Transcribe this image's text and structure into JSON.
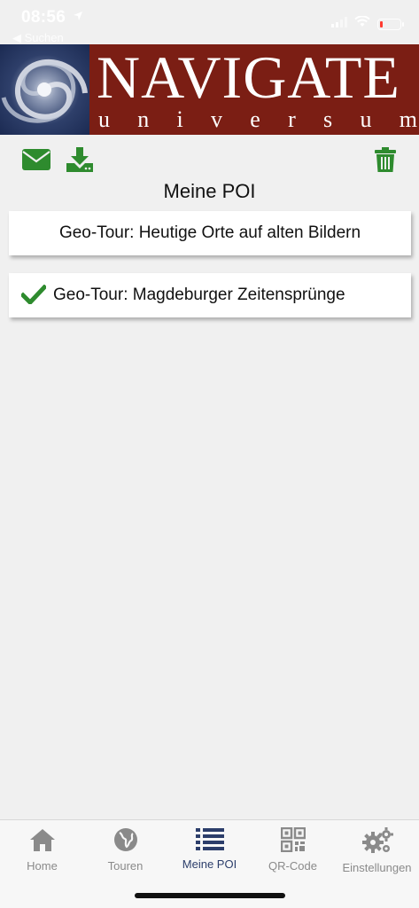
{
  "status": {
    "time": "08:56",
    "back_label": "◀ Suchen"
  },
  "banner": {
    "title": "NAVIGATE",
    "subtitle_letters": [
      "u",
      "n",
      "i",
      "v",
      "e",
      "r",
      "s",
      "u",
      "m"
    ]
  },
  "toolbar": {
    "mail_icon": "envelope-icon",
    "download_icon": "download-icon",
    "trash_icon": "trash-icon",
    "accent_color": "#2e8b2e"
  },
  "page": {
    "title": "Meine POI"
  },
  "poi_items": [
    {
      "label": "Geo-Tour: Heutige Orte auf alten Bildern",
      "checked": false
    },
    {
      "label": "Geo-Tour: Magdeburger Zeitensprünge",
      "checked": true
    }
  ],
  "tabbar": {
    "tabs": [
      {
        "label": "Home",
        "icon": "home-icon"
      },
      {
        "label": "Touren",
        "icon": "globe-icon"
      },
      {
        "label": "Meine POI",
        "icon": "list-icon",
        "active": true
      },
      {
        "label": "QR-Code",
        "icon": "qr-code-icon"
      },
      {
        "label": "Einstellungen",
        "icon": "gears-icon"
      }
    ],
    "active_color": "#2c3e6b",
    "inactive_color": "#8a8a8a"
  }
}
